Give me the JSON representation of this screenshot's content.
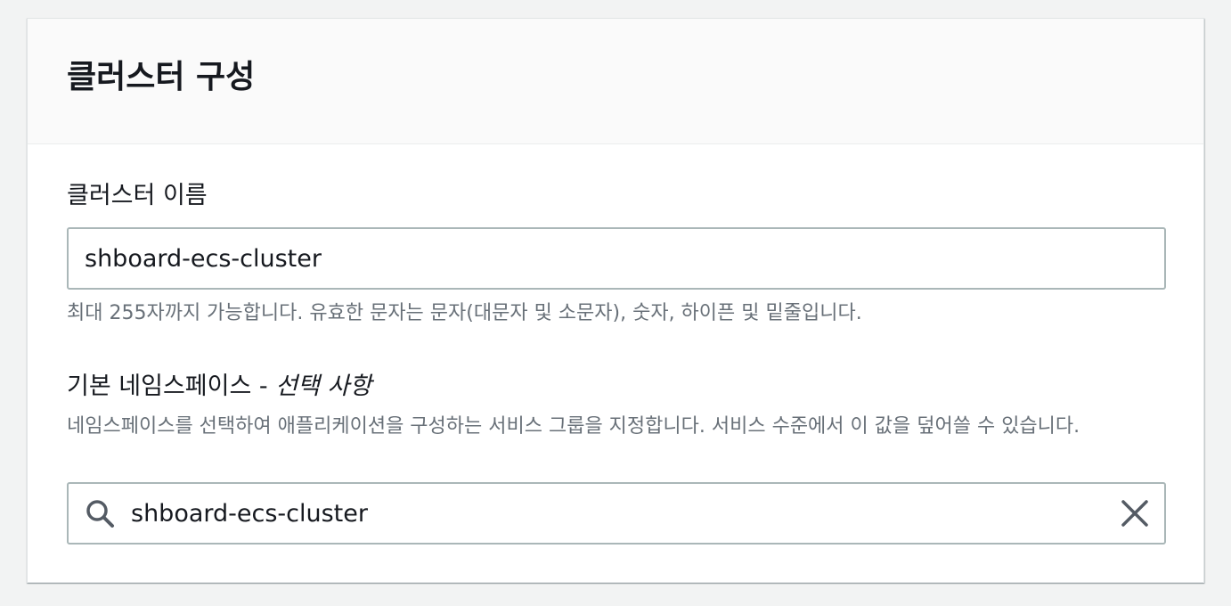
{
  "section": {
    "title": "클러스터 구성"
  },
  "cluster_name": {
    "label": "클러스터 이름",
    "value": "shboard-ecs-cluster",
    "constraint": "최대 255자까지 가능합니다. 유효한 문자는 문자(대문자 및 소문자), 숫자, 하이픈 및 밑줄입니다."
  },
  "namespace": {
    "label": "기본 네임스페이스 - ",
    "label_optional": "선택 사항",
    "description": "네임스페이스를 선택하여 애플리케이션을 구성하는 서비스 그룹을 지정합니다. 서비스 수준에서 이 값을 덮어쓸 수 있습니다.",
    "value": "shboard-ecs-cluster"
  },
  "icons": {
    "search": "search-icon",
    "clear": "close-icon"
  },
  "colors": {
    "border": "#aab7b8",
    "muted_text": "#687078",
    "header_bg": "#fafafa"
  }
}
